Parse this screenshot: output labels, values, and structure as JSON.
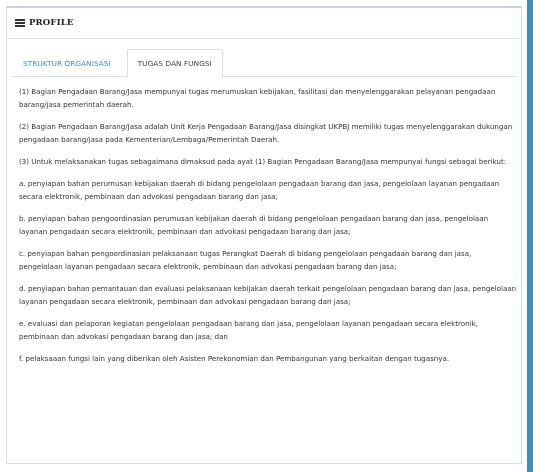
{
  "panel": {
    "title": "PROFILE",
    "icon": "list-icon"
  },
  "tabs": [
    {
      "label": "STRUKTUR ORGANISASI",
      "active": false
    },
    {
      "label": "TUGAS DAN FUNGSI",
      "active": true
    }
  ],
  "content": {
    "paragraphs": [
      "(1) Bagian Pengadaan Barang/Jasa mempunyai tugas merumuskan kebijakan, fasilitasi dan menyelenggarakan pelayanan pengadaan barang/jasa pemerintah daerah.",
      "(2) Bagian Pengadaan Barang/Jasa adalah Unit Kerja Pengadaan Barang/Jasa disingkat UKPBJ memiliki tugas menyelenggarakan dukungan pengadaan barang/jasa pada Kementerian/Lembaga/Pemerintah Daerah.",
      "(3) Untuk melaksanakan tugas sebagaimana dimaksud pada ayat (1) Bagian Pengadaan Barang/Jasa mempunyai fungsi sebagai berikut:",
      "a. penyiapan bahan perumusan kebijakan daerah di bidang pengelolaan pengadaan barang dan jasa, pengelolaan layanan pengadaan secara elektronik, pembinaan dan advokasi pengadaan barang dan jasa;",
      "b. penyiapan bahan pengoordinasian perumusan kebijakan daerah di bidang pengelolaan pengadaan barang dan jasa, pengelolaan layanan pengadaan secara elektronik, pembinaan dan advokasi pengadaan barang dan jasa;",
      "c. penyiapan bahan pengoordinasian pelaksanaan tugas Perangkat Daerah di bidang pengelolaan pengadaan barang dan jasa, pengelolaan layanan pengadaan secara elektronik, pembinaan dan advokasi pengadaan barang dan jasa;",
      "d. penyiapan bahan pemantauan dan evaluasi pelaksanaan kebijakan daerah terkait pengelolaan pengadaan barang dan jasa, pengelolaan layanan pengadaan secara elektronik, pembinaan dan advokasi pengadaan barang dan jasa;",
      "e. evaluasi dan pelaporan kegiatan pengelolaan pengadaan barang dan jasa, pengelolaan layanan pengadaan secara elektronik, pembinaan dan advokasi pengadaan barang dan jasa; dan",
      "f. pelaksaaan fungsi lain yang diberikan oleh Asisten Perekonomian dan Pembangunan yang berkaitan dengan tugasnya."
    ]
  },
  "colors": {
    "accent": "#3c8dbc",
    "text": "#333333"
  }
}
